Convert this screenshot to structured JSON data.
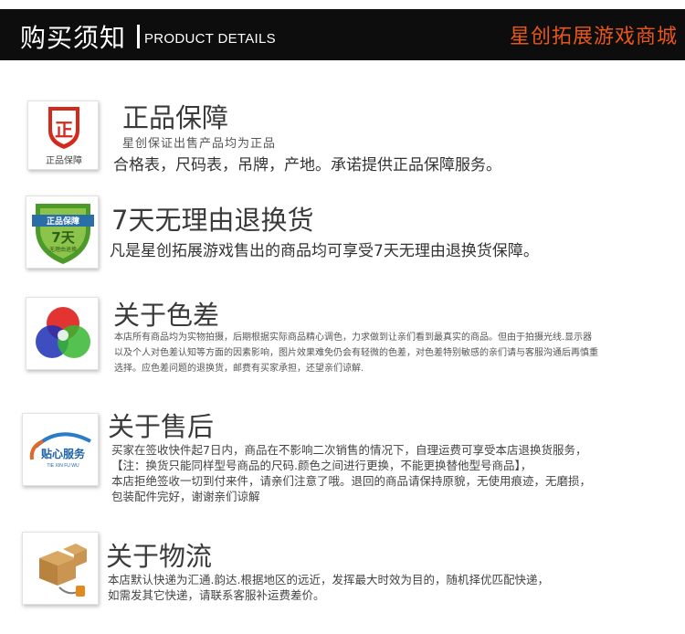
{
  "header": {
    "title_cn": "购买须知",
    "title_en": "PRODUCT DETAILS",
    "shop_name": "星创拓展游戏商城"
  },
  "sections": [
    {
      "title": "正品保障",
      "icon_label": "正品保障",
      "icon_glyph": "正",
      "subtitle": "星创保证出售产品均为正品",
      "lines": [
        "合格表，尺码表，吊牌，产地。承诺提供正品保障服务。"
      ]
    },
    {
      "title": "7天无理由退换货",
      "icon_top": "正品保障",
      "icon_mid": "7天",
      "icon_bottom": "无理由退换",
      "lines": [
        "凡是星创拓展游戏售出的商品均可享受7天无理由退换货保障。"
      ]
    },
    {
      "title": "关于色差",
      "lines": [
        "本店所有商品均为实物拍摄，后期根据实际商品精心调色，力求做到让亲们看到最真实的商品。但由于拍摄光线.显示器",
        "以及个人对色差认知等方面的因素影响，图片效果难免仍会有轻微的色差，对色差特别敏感的亲们请与客服沟通后再慎重",
        "选择。应色差问题的退换货，邮费有买家承担，还望亲们谅解."
      ]
    },
    {
      "title": "关于售后",
      "icon_brand": "贴心服务",
      "icon_sub": "TIE XIN FU WU",
      "lines": [
        "买家在签收快件起7日内，商品在不影响二次销售的情况下，自理运费可享受本店退换货服务，",
        "【注：换货只能同样型号商品的尺码.颜色之间进行更换，不能更换替他型号商品】，",
        "本店拒绝签收一切到付来件，请亲们注意了哦。退回的商品请保持原貌，无使用痕迹，无磨损，",
        "包装配件完好，谢谢亲们谅解"
      ]
    },
    {
      "title": "关于物流",
      "lines": [
        "本店默认快递为汇通.韵达.根据地区的远近，发挥最大时效为目的，随机择优匹配快递，",
        "如需发其它快递，请联系客服补运费差价。"
      ]
    }
  ],
  "colors": {
    "accent": "#e8561c",
    "header_bg": "#0d0d0d",
    "shield_red": "#d42a1e",
    "shield_green": "#4c9a2a"
  }
}
